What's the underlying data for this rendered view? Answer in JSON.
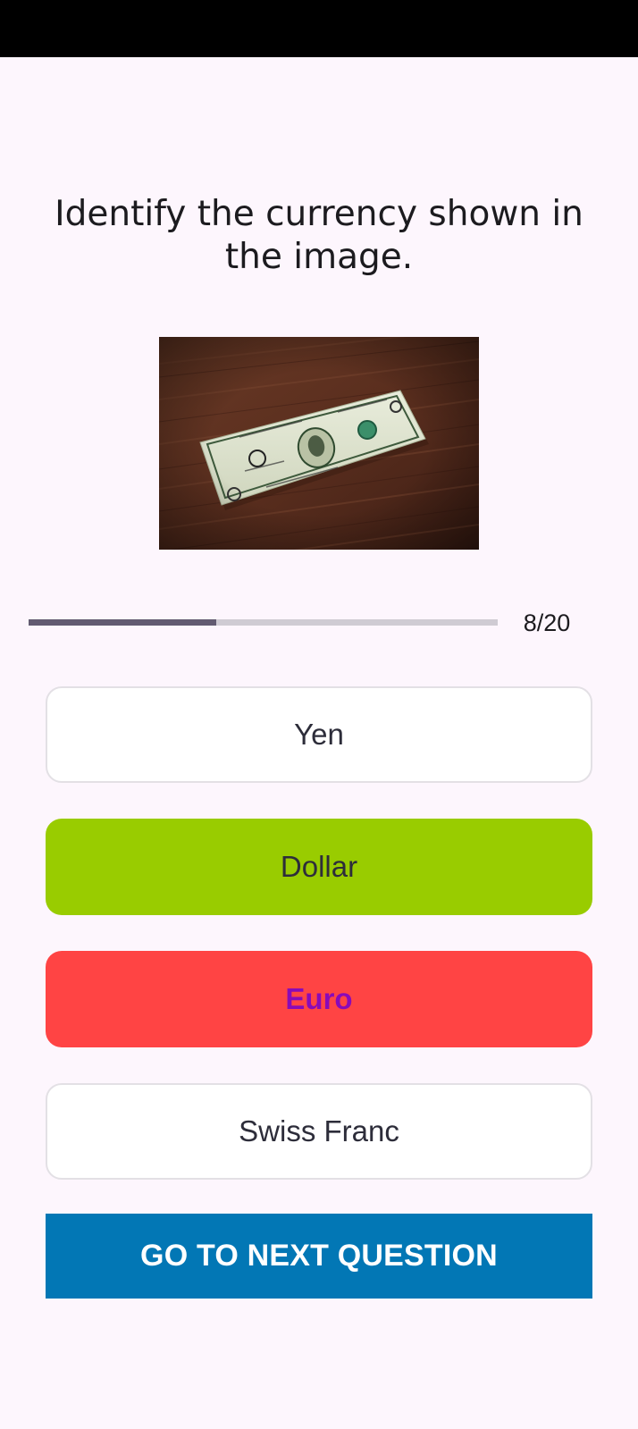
{
  "question": {
    "text": "Identify the currency shown in the image."
  },
  "image": {
    "subject": "one-dollar-banknote-on-wooden-table"
  },
  "progress": {
    "current": 8,
    "total": 20,
    "label": "8/20"
  },
  "options": [
    {
      "label": "Yen",
      "state": "unselected"
    },
    {
      "label": "Dollar",
      "state": "correct"
    },
    {
      "label": "Euro",
      "state": "wrong"
    },
    {
      "label": "Swiss Franc",
      "state": "unselected"
    }
  ],
  "next_button": {
    "label": "GO TO NEXT QUESTION"
  },
  "colors": {
    "background": "#fdf6fd",
    "correct": "#99cc00",
    "wrong": "#ff4444",
    "wrong_text": "#8a0ab8",
    "primary": "#0277b5",
    "progress_fill": "#625b71",
    "progress_track": "#cfcbd3"
  }
}
